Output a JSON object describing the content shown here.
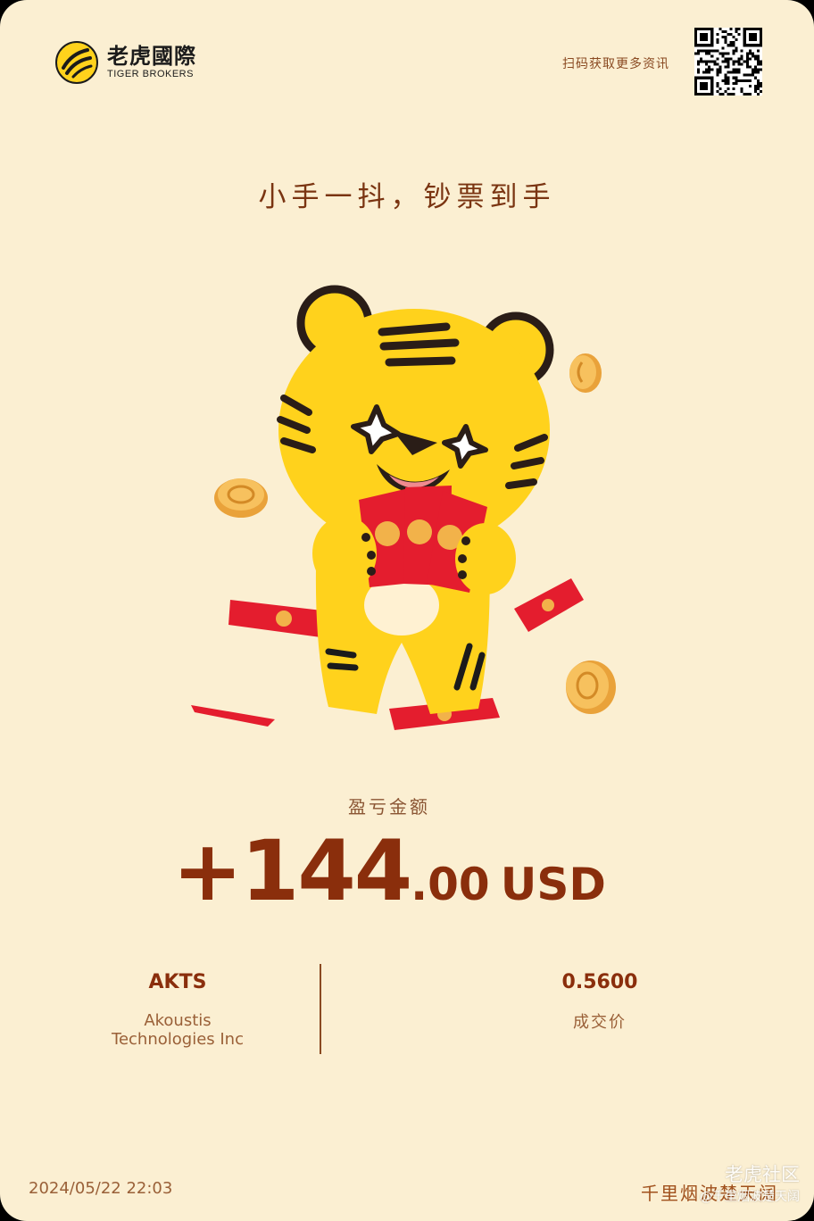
{
  "brand": {
    "name_cn": "老虎國際",
    "name_en": "TIGER BROKERS"
  },
  "header": {
    "scan_text": "扫码获取更多资讯"
  },
  "slogan": "小手一抖，钞票到手",
  "pnl": {
    "label": "盈亏金额",
    "amount_int": "+144",
    "amount_dec": ".00",
    "currency": "USD"
  },
  "stock": {
    "ticker": "AKTS",
    "company_line1": "Akoustis",
    "company_line2": "Technologies Inc"
  },
  "trade": {
    "price": "0.5600",
    "price_label": "成交价"
  },
  "footer": {
    "timestamp": "2024/05/22 22:03",
    "username": "千里烟波楚天阔"
  },
  "watermark": {
    "title": "老虎社区",
    "sub": "@千里烟波楚天阔"
  },
  "colors": {
    "background": "#fbefd2",
    "accent": "#8a2e0c",
    "tiger_yellow": "#ffd21c",
    "envelope_red": "#e41d2e"
  },
  "icons": {
    "logo": "tiger-stripe-logo-icon",
    "qr": "qr-code-icon",
    "illustration": "tiger-mascot-red-envelopes"
  }
}
